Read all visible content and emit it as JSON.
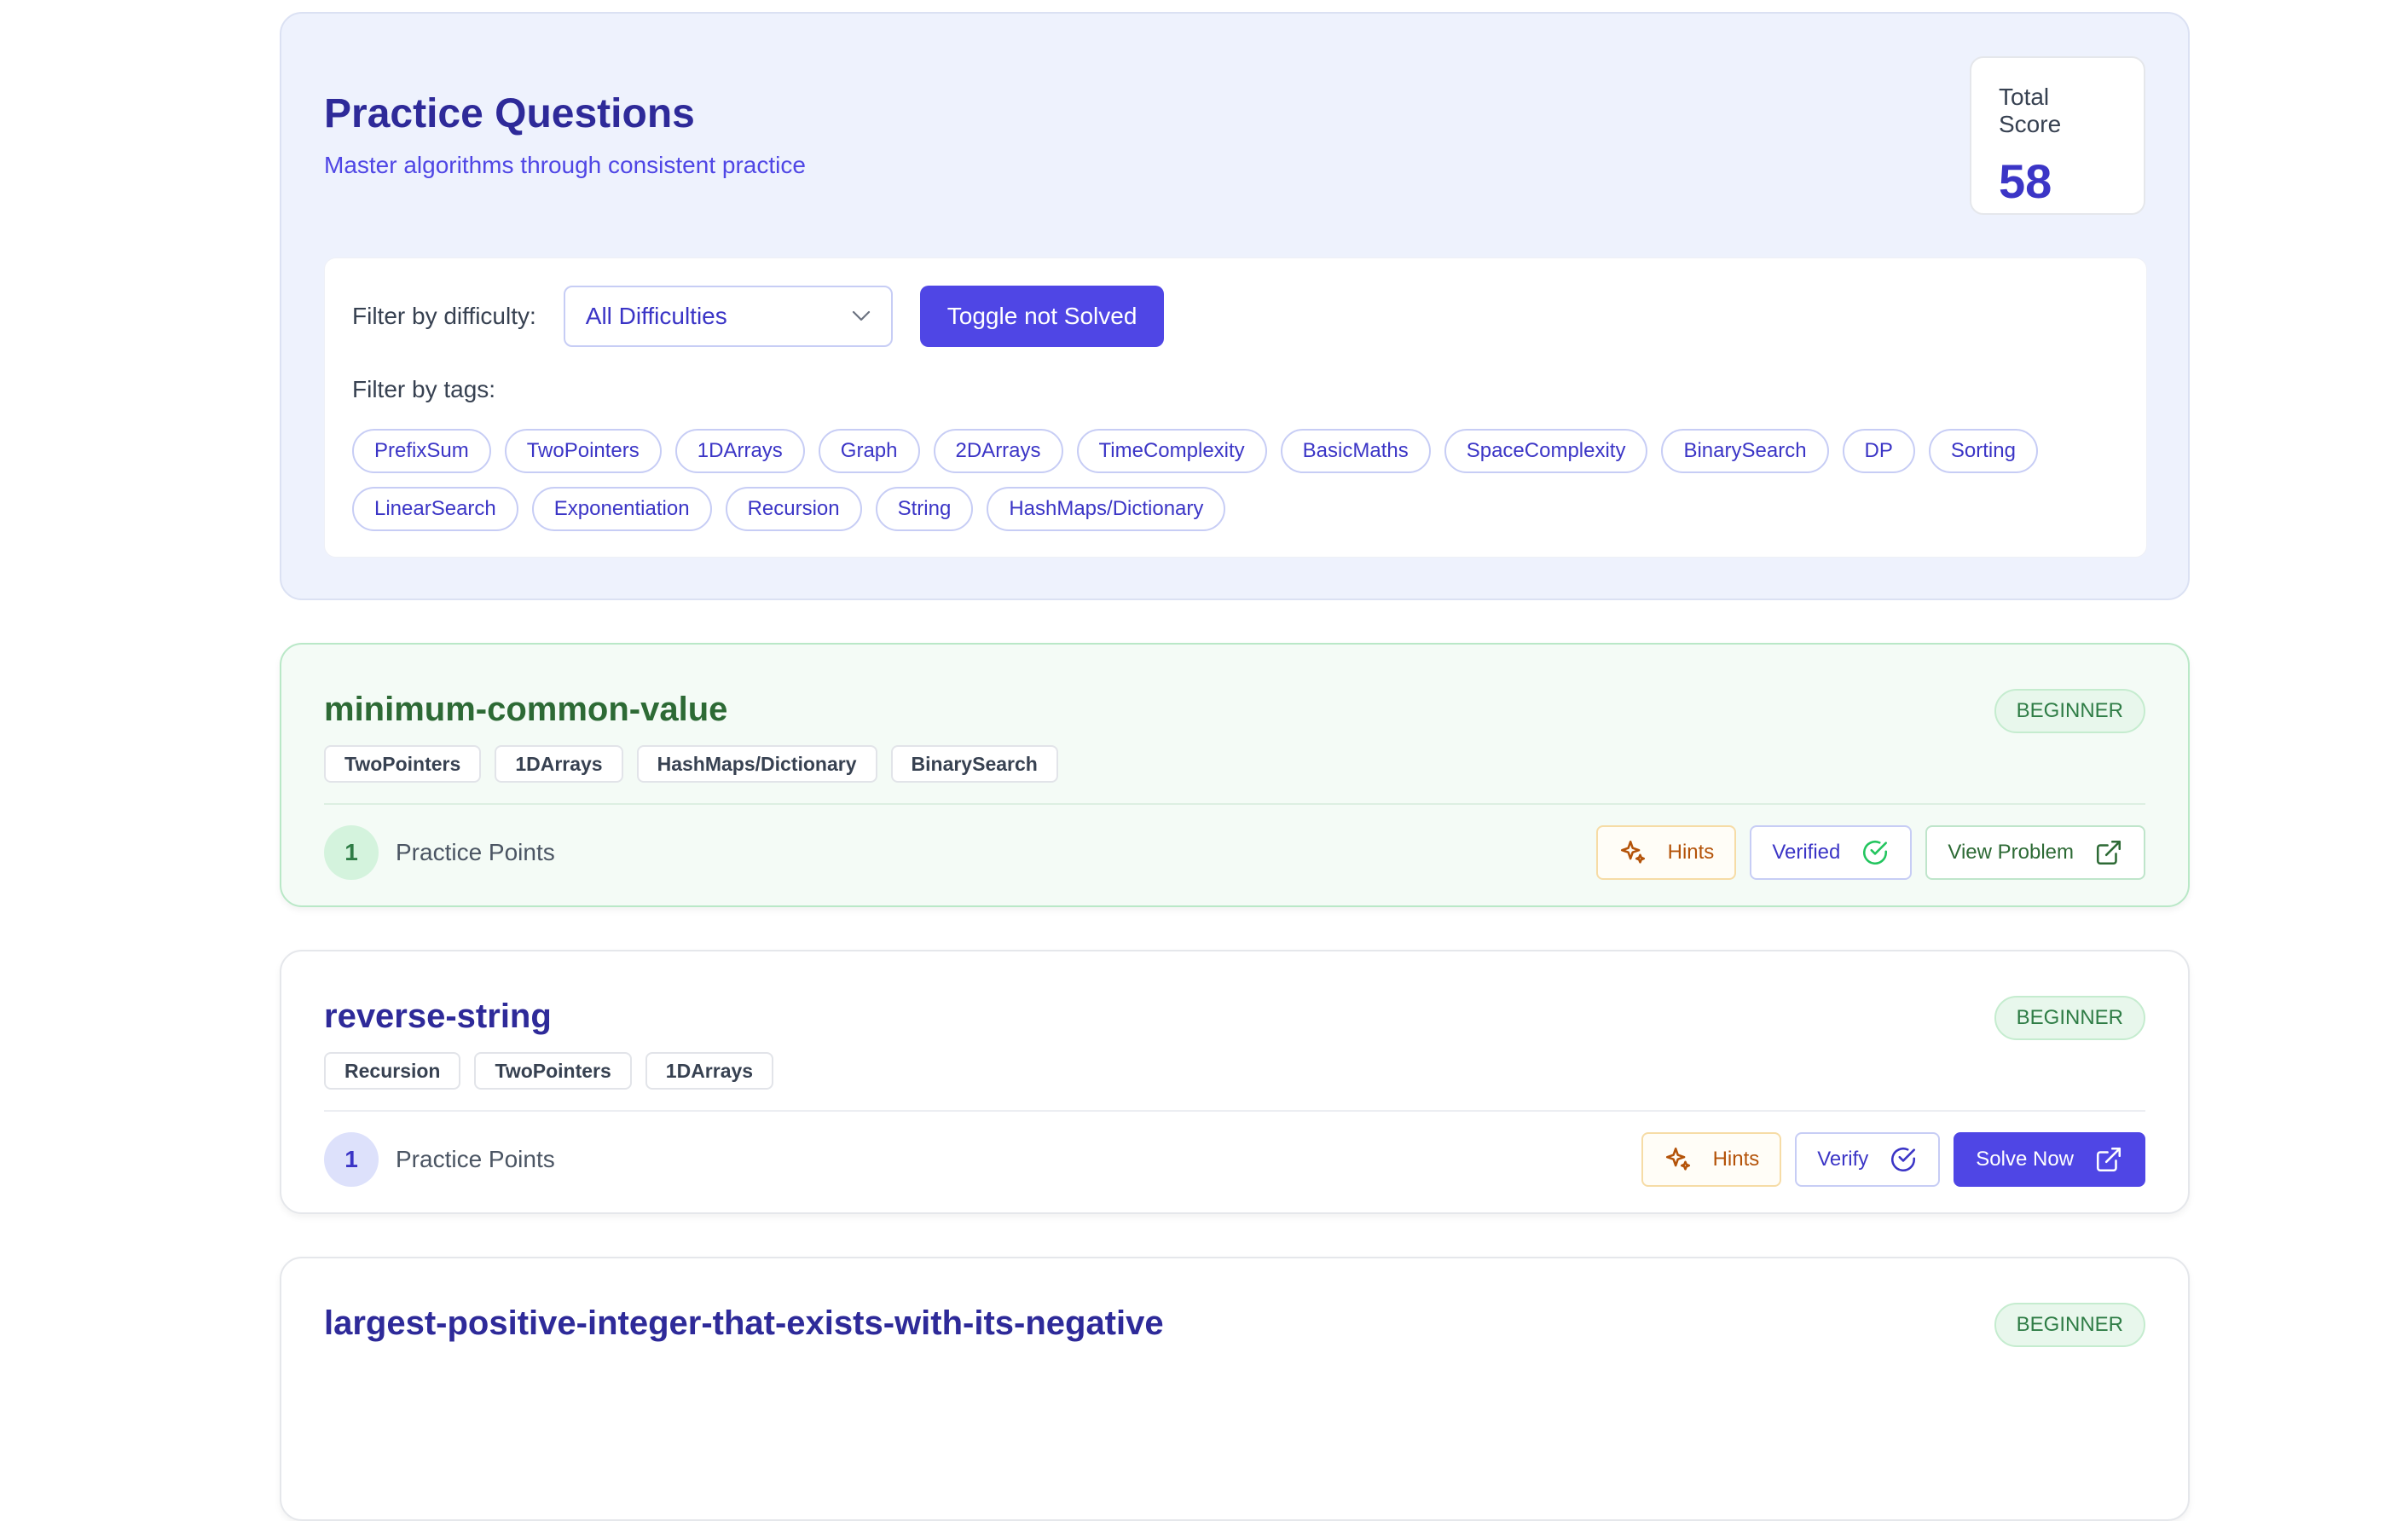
{
  "header": {
    "title": "Practice Questions",
    "subtitle": "Master algorithms through consistent practice",
    "score_label": "Total Score",
    "score_value": "58"
  },
  "filters": {
    "difficulty_label": "Filter by difficulty:",
    "difficulty_selected": "All Difficulties",
    "toggle_label": "Toggle not Solved",
    "tags_label": "Filter by tags:",
    "tags": [
      "PrefixSum",
      "TwoPointers",
      "1DArrays",
      "Graph",
      "2DArrays",
      "TimeComplexity",
      "BasicMaths",
      "SpaceComplexity",
      "BinarySearch",
      "DP",
      "Sorting",
      "LinearSearch",
      "Exponentiation",
      "Recursion",
      "String",
      "HashMaps/Dictionary"
    ]
  },
  "problems": [
    {
      "title": "minimum-common-value",
      "level": "BEGINNER",
      "tags": [
        "TwoPointers",
        "1DArrays",
        "HashMaps/Dictionary",
        "BinarySearch"
      ],
      "points": "1",
      "points_label": "Practice Points",
      "hints_label": "Hints",
      "verify_label": "Verified",
      "action_label": "View Problem"
    },
    {
      "title": "reverse-string",
      "level": "BEGINNER",
      "tags": [
        "Recursion",
        "TwoPointers",
        "1DArrays"
      ],
      "points": "1",
      "points_label": "Practice Points",
      "hints_label": "Hints",
      "verify_label": "Verify",
      "action_label": "Solve Now"
    },
    {
      "title": "largest-positive-integer-that-exists-with-its-negative",
      "level": "BEGINNER"
    }
  ],
  "colors": {
    "primary": "#4f46e5",
    "title": "#2e2a99",
    "solved_green": "#2d6a35",
    "hint_orange": "#b45309"
  }
}
